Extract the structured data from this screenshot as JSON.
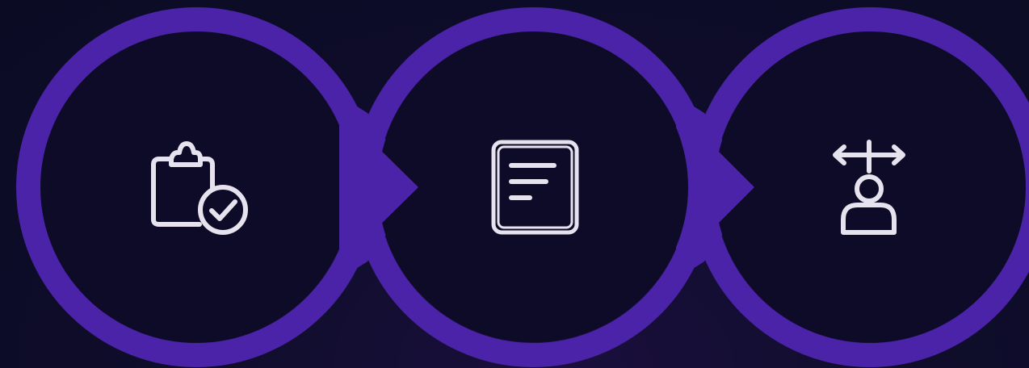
{
  "theme": {
    "background": "#0f0d2b",
    "ring_color": "#4a23a8",
    "ring_edge": "#3b1c8c",
    "circle_fill": "#0e0b28",
    "icon_color": "#e6e3ee"
  },
  "steps": [
    {
      "icon": "clipboard-check-icon"
    },
    {
      "icon": "document-lines-icon"
    },
    {
      "icon": "person-directions-icon"
    }
  ]
}
